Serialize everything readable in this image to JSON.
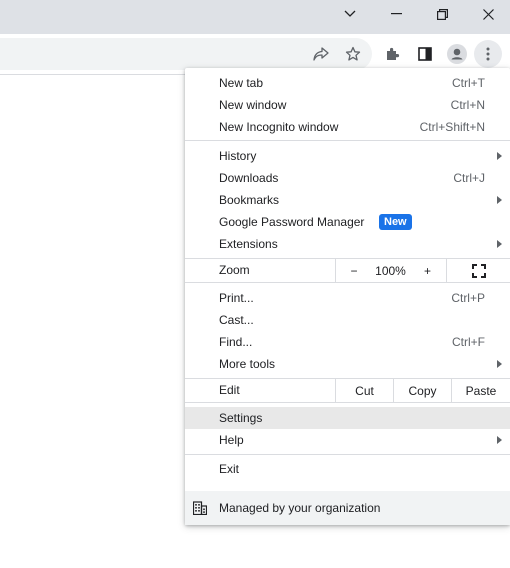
{
  "window_controls": {
    "tabsearch_icon": "chevron-down-icon",
    "minimize_icon": "minimize-icon",
    "restore_icon": "restore-icon",
    "close_icon": "close-icon"
  },
  "toolbar": {
    "icons": [
      "share-icon",
      "star-icon",
      "extensions-puzzle-icon",
      "side-panel-icon",
      "profile-icon",
      "more-vert-icon"
    ]
  },
  "menu": {
    "new_tab": {
      "label": "New tab",
      "shortcut": "Ctrl+T"
    },
    "new_window": {
      "label": "New window",
      "shortcut": "Ctrl+N"
    },
    "new_incognito": {
      "label": "New Incognito window",
      "shortcut": "Ctrl+Shift+N"
    },
    "history": {
      "label": "History"
    },
    "downloads": {
      "label": "Downloads",
      "shortcut": "Ctrl+J"
    },
    "bookmarks": {
      "label": "Bookmarks"
    },
    "password_manager": {
      "label": "Google Password Manager",
      "badge": "New"
    },
    "extensions": {
      "label": "Extensions"
    },
    "zoom": {
      "label": "Zoom",
      "minus": "−",
      "value": "100%",
      "plus": "+"
    },
    "print": {
      "label": "Print...",
      "shortcut": "Ctrl+P"
    },
    "cast": {
      "label": "Cast..."
    },
    "find": {
      "label": "Find...",
      "shortcut": "Ctrl+F"
    },
    "more_tools": {
      "label": "More tools"
    },
    "edit": {
      "label": "Edit",
      "cut": "Cut",
      "copy": "Copy",
      "paste": "Paste"
    },
    "settings": {
      "label": "Settings"
    },
    "help": {
      "label": "Help"
    },
    "exit": {
      "label": "Exit"
    },
    "managed": {
      "label": "Managed by your organization"
    }
  },
  "colors": {
    "accent": "#1a73e8",
    "titlebar": "#dee1e6",
    "hover": "#e8e8e8"
  }
}
